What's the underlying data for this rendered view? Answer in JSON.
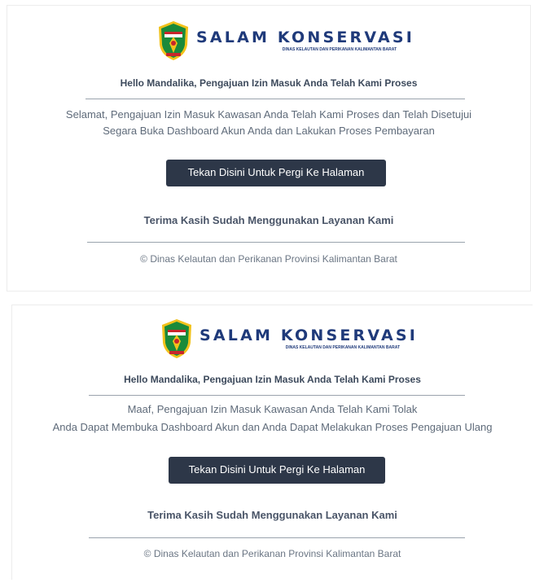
{
  "brand": {
    "title": "SALAM KONSERVASI",
    "subtitle": "DINAS KELAUTAN DAN PERIKANAN KALIMANTAN BARAT",
    "logo_icon": "west-kalimantan-emblem-icon",
    "colors": {
      "title": "#1f3a7a",
      "emblem_green": "#1a8a3a",
      "emblem_red": "#c8262b",
      "emblem_yellow": "#f2c21b"
    }
  },
  "emails": [
    {
      "greeting": "Hello Mandalika, Pengajuan Izin Masuk Anda Telah Kami Proses",
      "message_line1": "Selamat, Pengajuan Izin Masuk Kawasan Anda Telah Kami Proses dan Telah Disetujui",
      "message_line2": "Segara Buka Dashboard Akun Anda dan Lakukan Proses Pembayaran",
      "button_label": "Tekan Disini Untuk Pergi Ke Halaman",
      "thanks": "Terima Kasih Sudah Menggunakan Layanan Kami",
      "footer": "© Dinas Kelautan dan Perikanan Provinsi Kalimantan Barat"
    },
    {
      "greeting": "Hello Mandalika, Pengajuan Izin Masuk Anda Telah Kami Proses",
      "message_line1": "Maaf, Pengajuan Izin Masuk Kawasan Anda Telah Kami Tolak",
      "message_line2": "Anda Dapat Membuka Dashboard Akun dan Anda Dapat Melakukan Proses Pengajuan Ulang",
      "button_label": "Tekan Disini Untuk Pergi Ke Halaman",
      "thanks": "Terima Kasih Sudah Menggunakan Layanan Kami",
      "footer": "© Dinas Kelautan dan Perikanan Provinsi Kalimantan Barat"
    }
  ],
  "theme": {
    "button_bg": "#2d3748",
    "button_text": "#ffffff",
    "rule": "#9aa3ad"
  }
}
